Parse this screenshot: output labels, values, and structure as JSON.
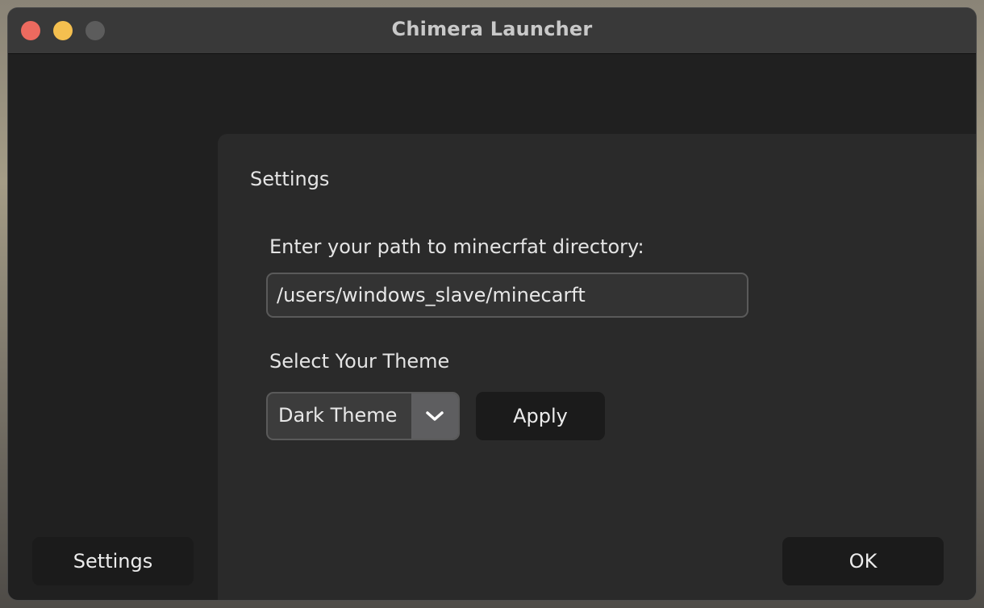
{
  "window": {
    "title": "Chimera Launcher"
  },
  "settings_panel": {
    "title": "Settings",
    "path_label": "Enter your path to minecrfat directory:",
    "path_value": "/users/windows_slave/minecarft",
    "theme_label": "Select Your Theme",
    "theme_selected": "Dark Theme",
    "apply_label": "Apply"
  },
  "footer": {
    "settings_label": "Settings",
    "ok_label": "OK"
  },
  "icons": {
    "close": "close-icon",
    "minimize": "minimize-icon",
    "zoom": "zoom-icon",
    "dropdown": "chevron-down-icon"
  },
  "colors": {
    "close": "#ec6a5f",
    "minimize": "#f4bf4f",
    "zoom": "#5c5c5c"
  }
}
